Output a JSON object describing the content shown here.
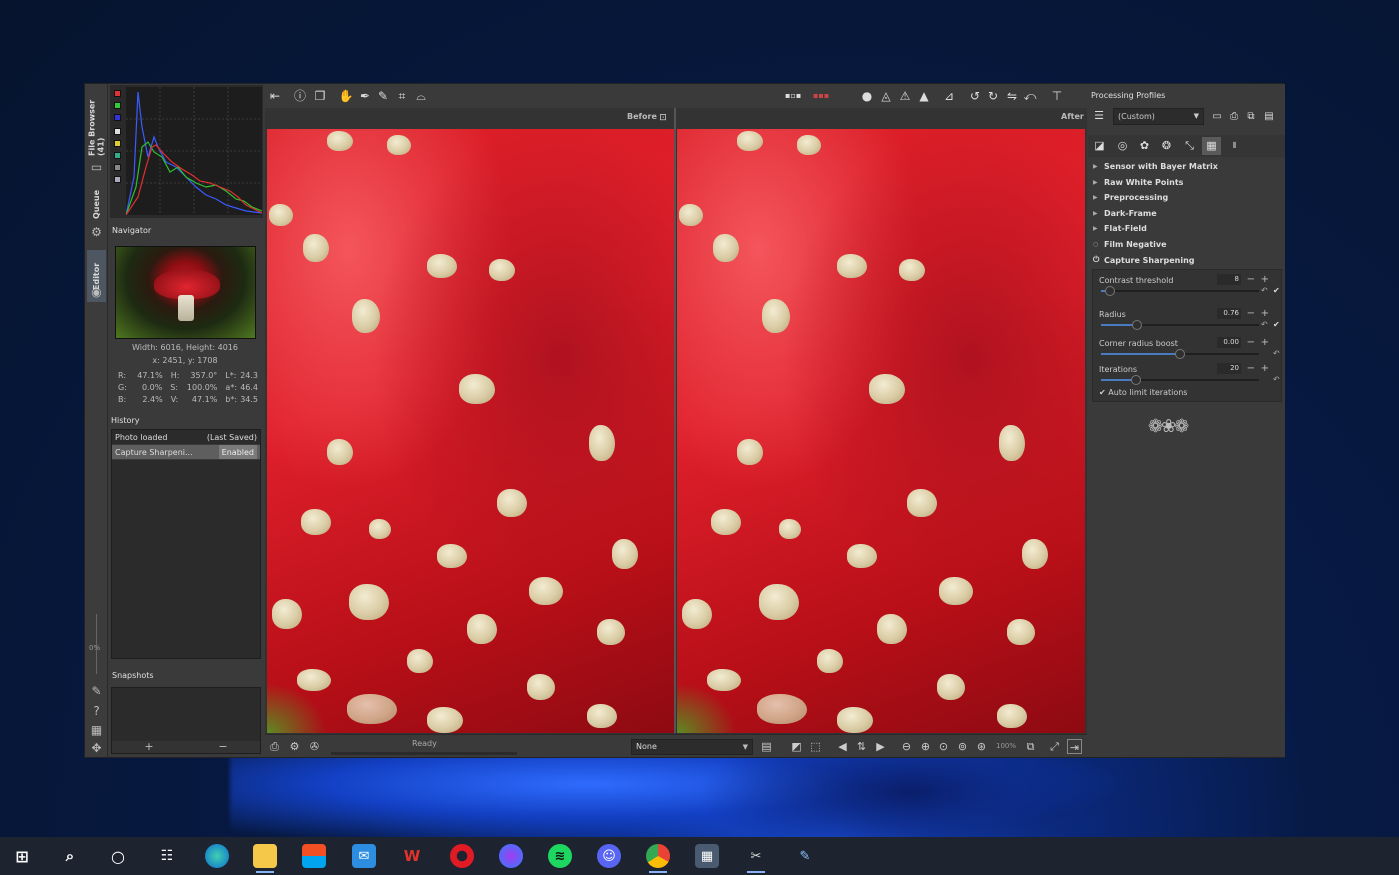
{
  "app": {
    "vertical_tabs": [
      "File Browser (41)",
      "Queue",
      "Editor"
    ],
    "filmstrip_pct": "0%"
  },
  "navigator": {
    "title": "Navigator",
    "dimensions": "Width: 6016, Height: 4016",
    "coords": "x: 2451, y: 1708",
    "values": [
      {
        "k1": "R:",
        "v1": "47.1%",
        "k2": "H:",
        "v2": "357.0°",
        "k3": "L*:",
        "v3": "24.3"
      },
      {
        "k1": "G:",
        "v1": "0.0%",
        "k2": "S:",
        "v2": "100.0%",
        "k3": "a*:",
        "v3": "46.4"
      },
      {
        "k1": "B:",
        "v1": "2.4%",
        "k2": "V:",
        "v2": "47.1%",
        "k3": "b*:",
        "v3": "34.5"
      }
    ]
  },
  "history": {
    "title": "History",
    "rows": [
      {
        "left": "Photo loaded",
        "right": "(Last Saved)"
      },
      {
        "left": "Capture Sharpeni...",
        "right": "Enabled"
      }
    ]
  },
  "snapshots": {
    "title": "Snapshots",
    "add": "+",
    "remove": "−"
  },
  "viewer": {
    "before_label": "Before",
    "after_label": "After",
    "status": "Ready",
    "output_select": "None",
    "zoom": "100%"
  },
  "right_panel": {
    "title": "Processing Profiles",
    "profile": "(Custom)",
    "tools": [
      {
        "label": "Sensor with Bayer Matrix",
        "marker": "▶"
      },
      {
        "label": "Raw White Points",
        "marker": "▶"
      },
      {
        "label": "Preprocessing",
        "marker": "▶"
      },
      {
        "label": "Dark-Frame",
        "marker": "▶"
      },
      {
        "label": "Flat-Field",
        "marker": "▶"
      },
      {
        "label": "Film Negative",
        "marker": "○"
      },
      {
        "label": "Capture Sharpening",
        "marker": "⏻"
      }
    ],
    "capture_sharpening": {
      "params": [
        {
          "label": "Contrast threshold",
          "value": "8",
          "fraction": 0.06
        },
        {
          "label": "Radius",
          "value": "0.76",
          "fraction": 0.23
        },
        {
          "label": "Corner radius boost",
          "value": "0.00",
          "fraction": 0.5
        },
        {
          "label": "Iterations",
          "value": "20",
          "fraction": 0.22
        }
      ],
      "auto_limit": "Auto limit iterations"
    }
  },
  "colors": {
    "accent": "#4a7bc0",
    "panel_bg": "#3a3a3a",
    "histogram_red": "#e23030",
    "histogram_green": "#2ec02e",
    "histogram_blue": "#3a5bff"
  },
  "taskbar": {
    "icons": [
      "start-icon",
      "search-icon",
      "cortana-icon",
      "task-view-icon",
      "edge-icon",
      "file-explorer-icon",
      "store-icon",
      "mail-icon",
      "wps-icon",
      "opera-icon",
      "messenger-icon",
      "spotify-icon",
      "discord-icon",
      "chrome-icon",
      "calculator-icon",
      "rawtherapee-icon",
      "paint-icon"
    ]
  }
}
